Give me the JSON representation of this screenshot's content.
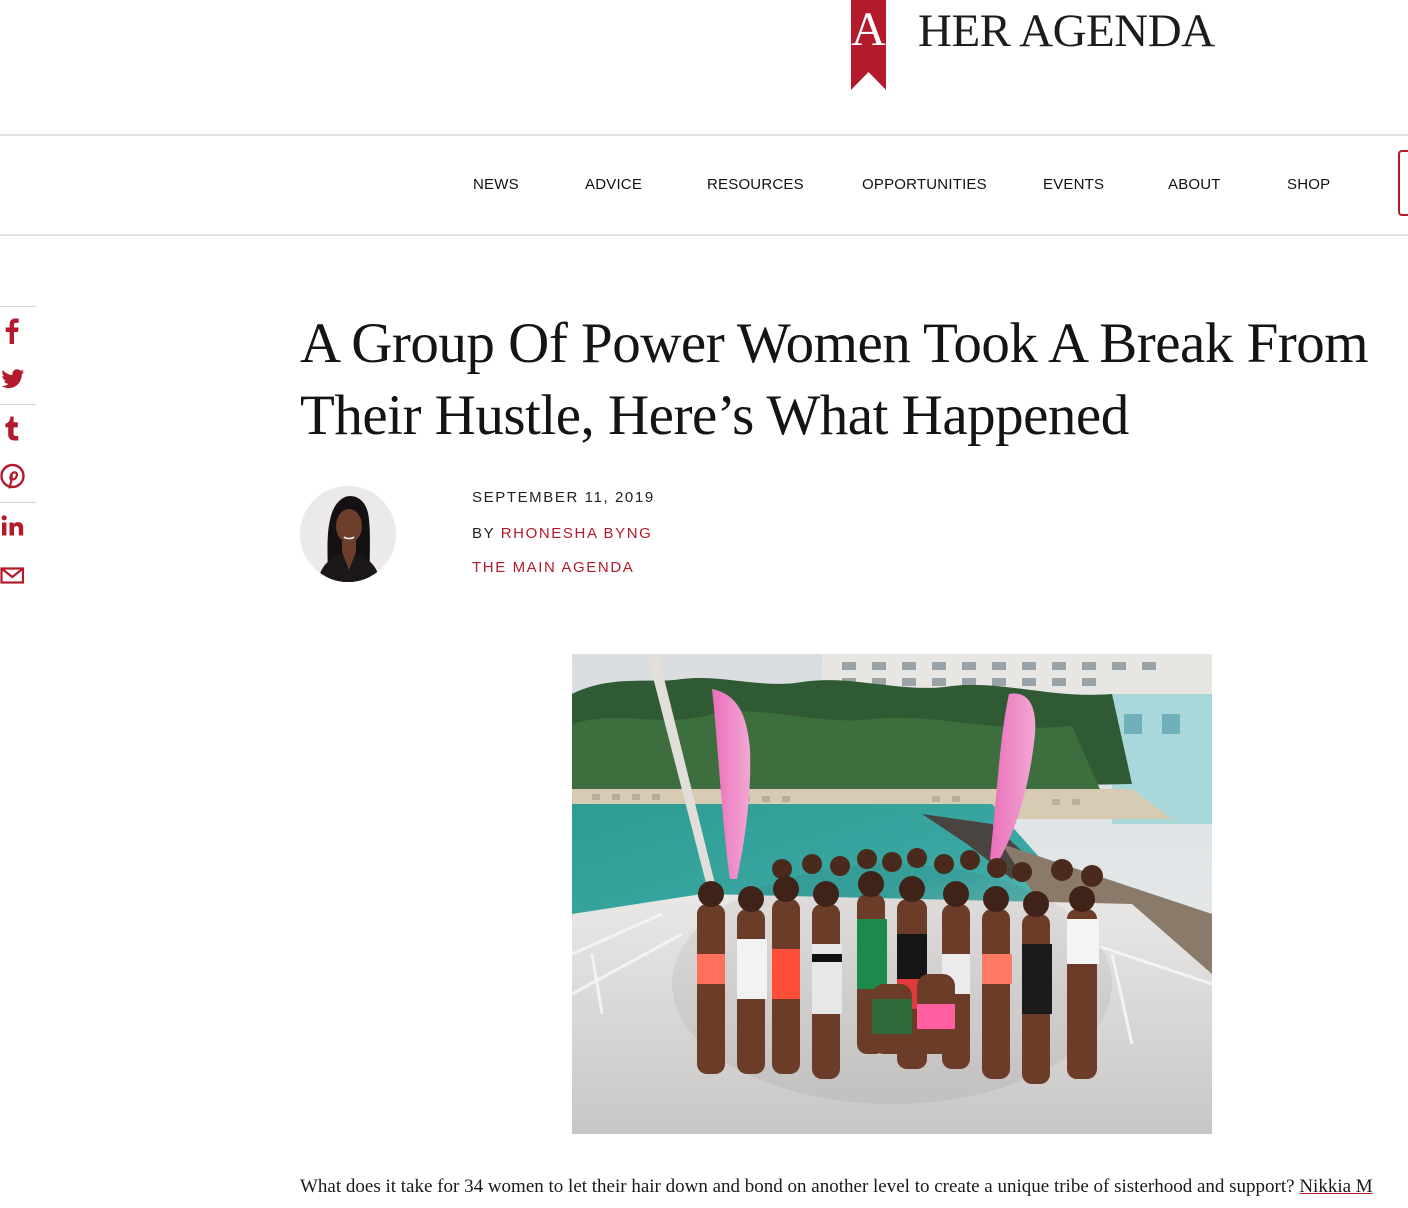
{
  "brand": {
    "logo_letter": "A",
    "name": "HER AGENDA",
    "accent_color": "#b31b2c"
  },
  "nav": {
    "items": [
      {
        "label": "NEWS"
      },
      {
        "label": "ADVICE"
      },
      {
        "label": "RESOURCES"
      },
      {
        "label": "OPPORTUNITIES"
      },
      {
        "label": "EVENTS"
      },
      {
        "label": "ABOUT"
      },
      {
        "label": "SHOP"
      }
    ]
  },
  "share": {
    "icons": [
      "facebook-icon",
      "twitter-icon",
      "tumblr-icon",
      "pinterest-icon",
      "linkedin-icon",
      "email-icon"
    ]
  },
  "article": {
    "title": "A Group Of Power Women Took A Break From Their Hustle, Here’s What Happened",
    "date": "SEPTEMBER 11, 2019",
    "by_prefix": "BY",
    "author": "RHONESHA BYNG",
    "category": "THE MAIN AGENDA",
    "body_intro": "What does it take for 34 women to let their hair down and bond on another level to create a unique tribe of sisterhood and support? ",
    "body_link": "Nikkia M"
  }
}
